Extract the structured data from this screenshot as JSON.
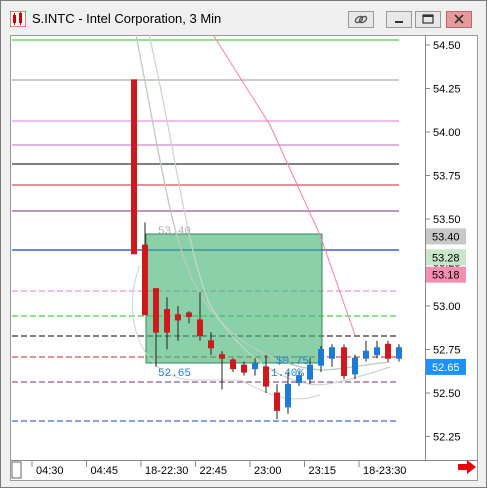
{
  "window": {
    "title": "S.INTC - Intel Corporation, 3 Min"
  },
  "icons": {
    "app": "app-icon",
    "link": "link-icon",
    "minimize": "minimize-icon",
    "restore": "restore-icon",
    "close": "close-icon",
    "scroll_right": "red-arrow-right-icon"
  },
  "colors": {
    "up_candle": "#1c7ad8",
    "down_candle": "#d0191c",
    "rect_fill": "#3cb371",
    "price_box_gray": "#c8c8c8",
    "price_box_green": "#c8e6c9",
    "price_box_pink": "#f48fb1",
    "last_price": "#1e90ff"
  },
  "price_axis": {
    "ticks": [
      "54.50",
      "54.25",
      "54.00",
      "53.75",
      "53.50",
      "53.25",
      "53.00",
      "52.75",
      "52.50",
      "52.25"
    ],
    "tags": [
      {
        "label": "53.40",
        "kind": "gray"
      },
      {
        "label": "53.28",
        "kind": "green"
      },
      {
        "label": "53.18",
        "kind": "pink"
      },
      {
        "label": "52.65",
        "kind": "blue"
      }
    ]
  },
  "time_axis": {
    "ticks": [
      "04:30",
      "04:45",
      "18-22:30",
      "22:45",
      "23:00",
      "23:15",
      "18-23:30"
    ]
  },
  "annotations": {
    "top_price": "53.40",
    "bottom_price": "52.65",
    "change": "$0.75",
    "change_pct": "1.40%"
  }
}
